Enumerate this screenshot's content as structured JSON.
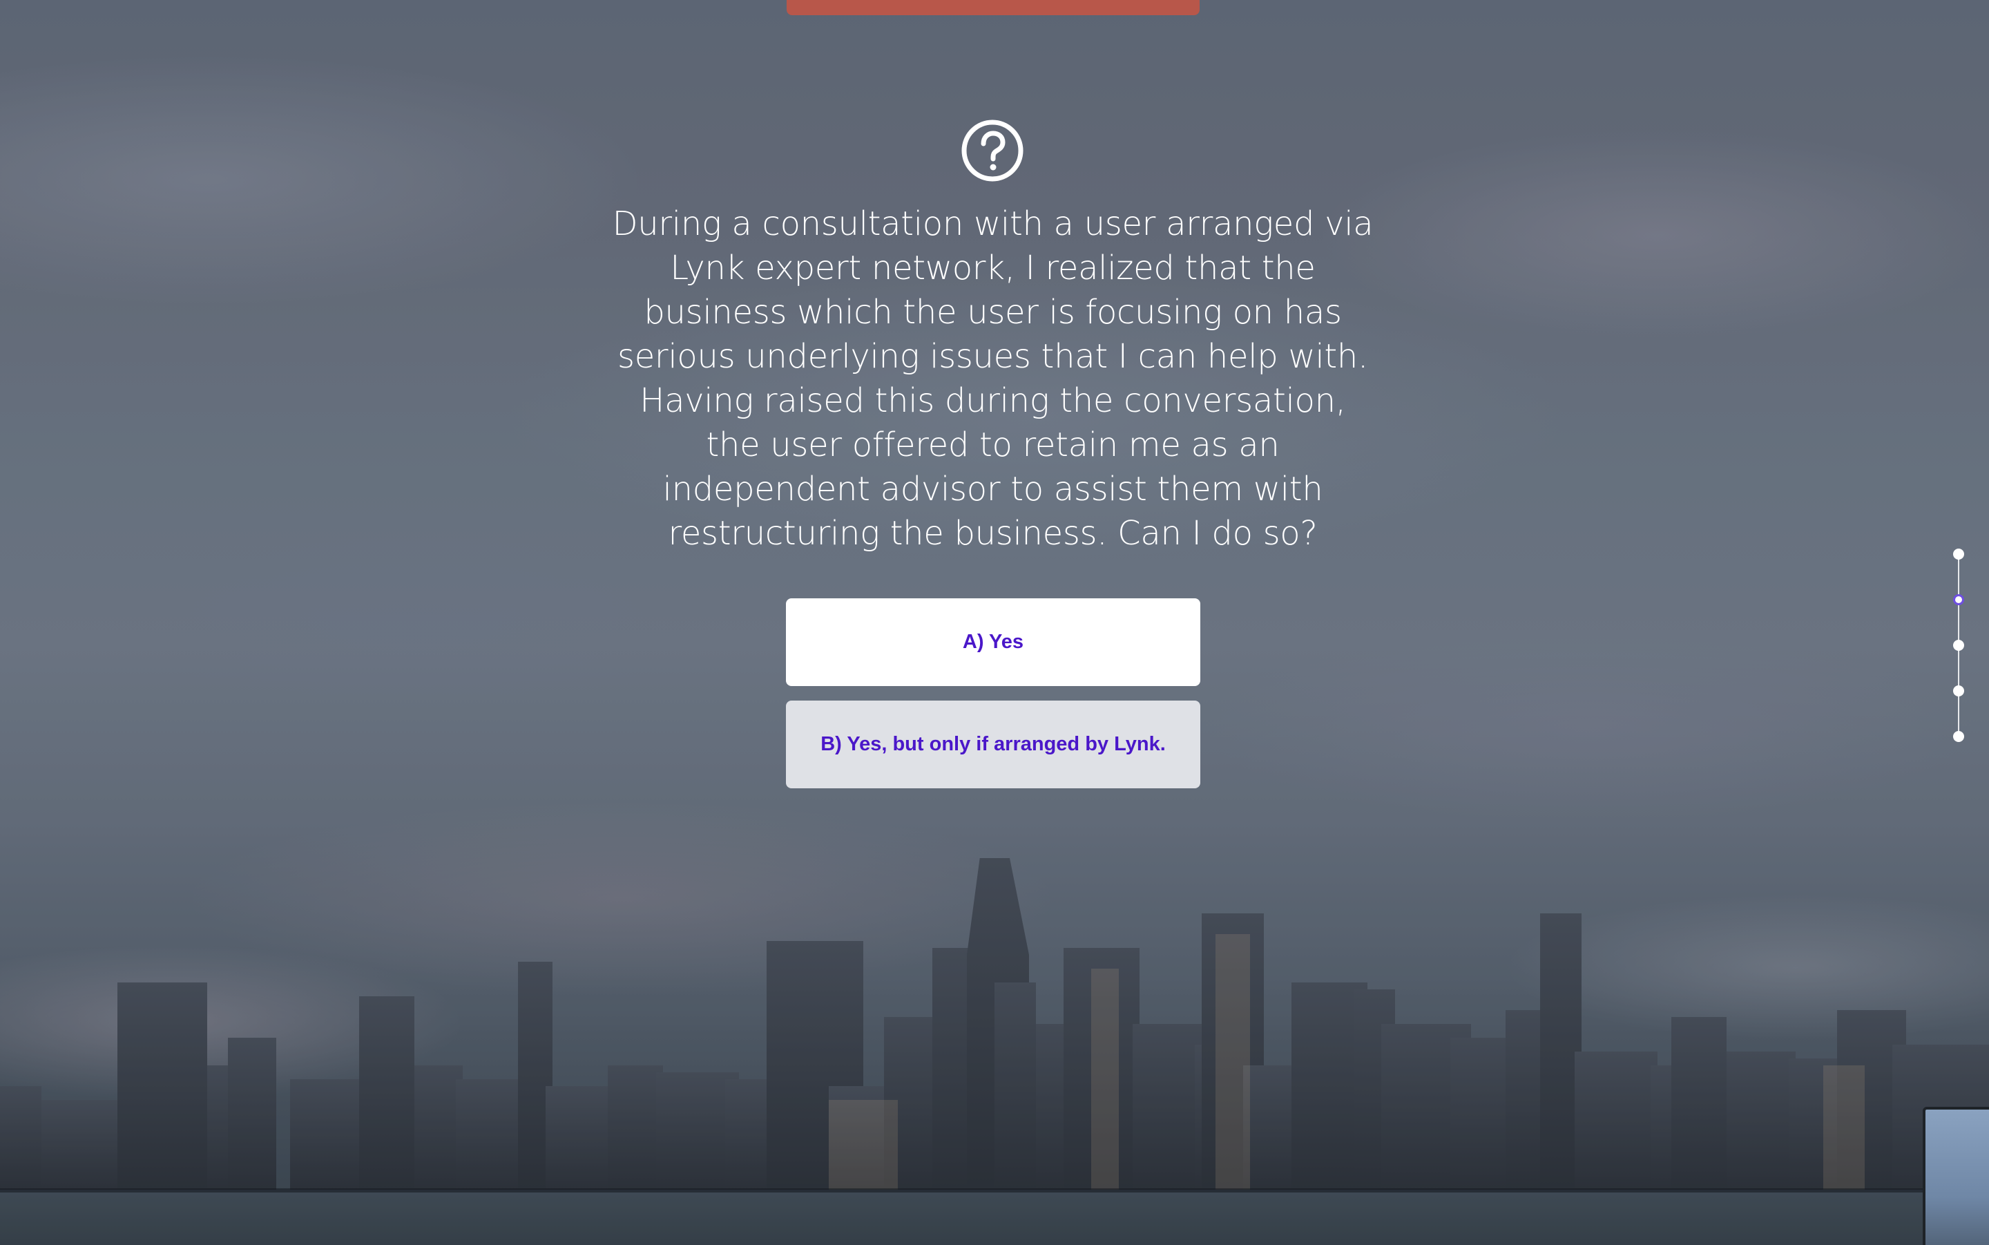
{
  "question": {
    "icon": "question-circle-icon",
    "text": "During a consultation with a user arranged via Lynk expert network, I realized that the business which the user is focusing on has serious underlying issues that I can help with. Having raised this during the conversation, the user offered to retain me as an independent advisor to assist them with restructuring the business. Can I do so?"
  },
  "answers": [
    {
      "label": "A) Yes"
    },
    {
      "label": "B) Yes, but only if arranged by Lynk."
    }
  ],
  "progress": {
    "total_steps": 5,
    "active_step": 2
  },
  "colors": {
    "top_tab": "#b8574a",
    "answer_text": "#4a17c9",
    "answer_a_bg": "#ffffff",
    "answer_b_bg": "#dfe1e6",
    "active_dot": "#6e4fe0"
  }
}
